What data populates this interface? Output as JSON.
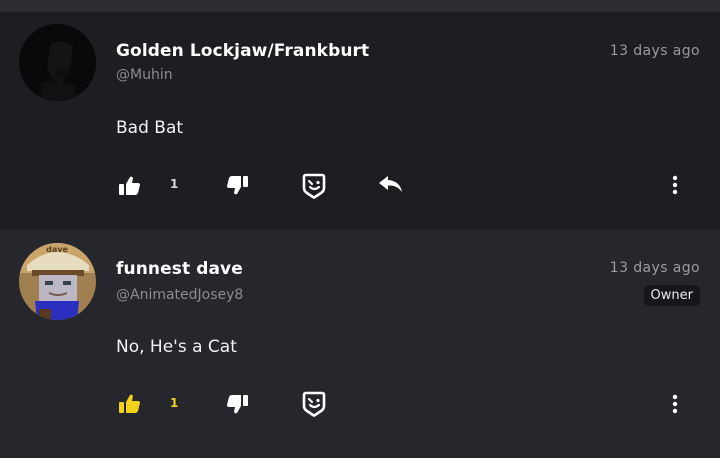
{
  "comments": [
    {
      "name": "Golden Lockjaw/Frankburt",
      "handle": "@Muhin",
      "time": "13 days ago",
      "text": "Bad Bat",
      "likes": "1",
      "liked": false
    },
    {
      "name": "funnest dave",
      "handle": "@AnimatedJosey8",
      "time": "13 days ago",
      "badge": "Owner",
      "text": "No, He's a Cat",
      "likes": "1",
      "liked": true,
      "avatar_hat_text": "dave"
    }
  ],
  "colors": {
    "liked": "#f3d21c",
    "icon": "#ffffff",
    "muted": "#8b8b91"
  }
}
